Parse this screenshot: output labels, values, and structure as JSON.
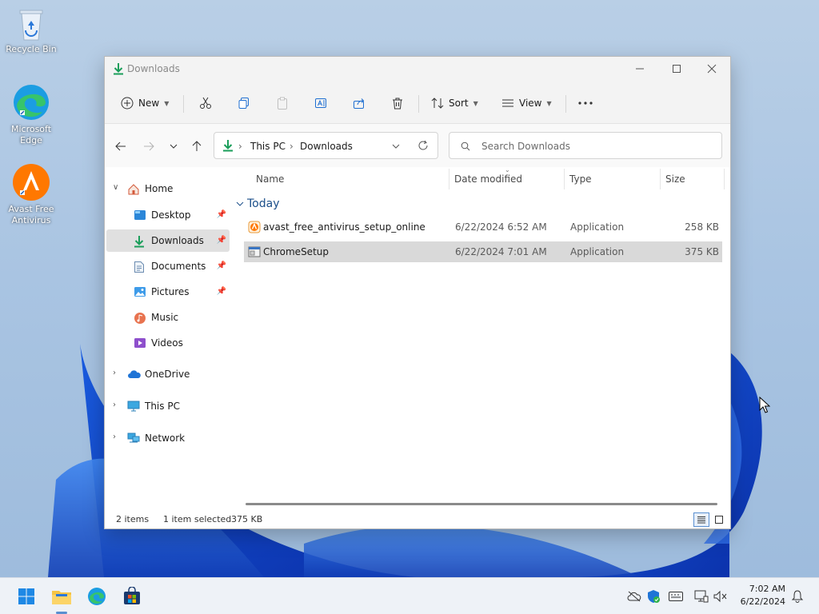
{
  "desktop": {
    "icons": [
      {
        "label": "Recycle Bin"
      },
      {
        "label": "Microsoft Edge"
      },
      {
        "label": "Avast Free Antivirus"
      }
    ]
  },
  "window": {
    "title": "Downloads",
    "toolbar": {
      "new_label": "New",
      "sort_label": "Sort",
      "view_label": "View"
    },
    "address": {
      "crumbs": [
        "This PC",
        "Downloads"
      ]
    },
    "search": {
      "placeholder": "Search Downloads"
    },
    "nav": {
      "home": "Home",
      "quick_access": [
        {
          "label": "Desktop",
          "pinned": true
        },
        {
          "label": "Downloads",
          "pinned": true,
          "selected": true
        },
        {
          "label": "Documents",
          "pinned": true
        },
        {
          "label": "Pictures",
          "pinned": true
        },
        {
          "label": "Music"
        },
        {
          "label": "Videos"
        }
      ],
      "roots": [
        {
          "label": "OneDrive"
        },
        {
          "label": "This PC"
        },
        {
          "label": "Network"
        }
      ]
    },
    "columns": {
      "name": "Name",
      "date": "Date modified",
      "type": "Type",
      "size": "Size"
    },
    "group": "Today",
    "files": [
      {
        "name": "avast_free_antivirus_setup_online",
        "date": "6/22/2024 6:52 AM",
        "type": "Application",
        "size": "258 KB"
      },
      {
        "name": "ChromeSetup",
        "date": "6/22/2024 7:01 AM",
        "type": "Application",
        "size": "375 KB",
        "selected": true
      }
    ],
    "status": {
      "items": "2 items",
      "selected": "1 item selected",
      "selected_size": "375 KB"
    }
  },
  "taskbar": {
    "time": "7:02 AM",
    "date": "6/22/2024"
  },
  "colors": {
    "accent": "#0067c0",
    "download_green": "#1a9e5a",
    "selected_row": "#d9d9d9"
  }
}
